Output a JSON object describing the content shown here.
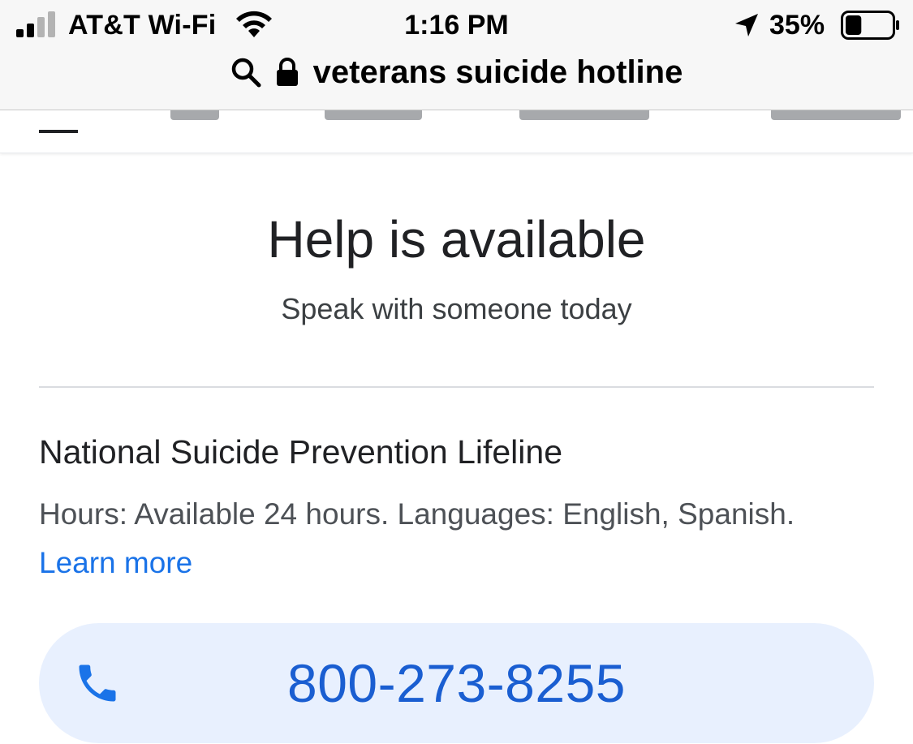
{
  "status_bar": {
    "carrier": "AT&T Wi-Fi",
    "time": "1:16 PM",
    "battery_percent": "35%",
    "battery_level": 0.35,
    "signal_bars_filled": 2,
    "signal_bars_total": 4,
    "icons": [
      "signal-icon",
      "wifi-icon",
      "location-arrow-icon",
      "battery-icon"
    ]
  },
  "address_bar": {
    "text": "veterans suicide hotline",
    "icons": [
      "search-icon",
      "lock-icon"
    ]
  },
  "help_card": {
    "title": "Help is available",
    "subtitle": "Speak with someone today"
  },
  "resource": {
    "name": "National Suicide Prevention Lifeline",
    "info": "Hours: Available 24 hours. Languages: English, Spanish.",
    "learn_more_label": "Learn more",
    "phone": "800-273-8255",
    "phone_icon": "phone-icon"
  },
  "colors": {
    "link": "#1a73e8",
    "phone_text": "#1a5ed1",
    "call_button_bg": "#e8f0fe"
  }
}
